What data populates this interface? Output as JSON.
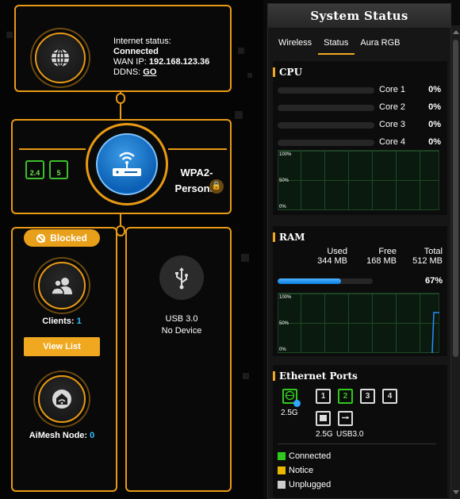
{
  "internet": {
    "status_label": "Internet status:",
    "status_value": "Connected",
    "wan_label": "WAN IP:",
    "wan_ip": "192.168.123.36",
    "ddns_label": "DDNS:",
    "ddns_link": "GO"
  },
  "router": {
    "band_24": "2.4",
    "band_5": "5",
    "security_line1": "WPA2-",
    "security_line2": "Personal"
  },
  "clients": {
    "blocked_label": "Blocked",
    "label": "Clients:",
    "count": "1",
    "view_list": "View List"
  },
  "aimesh": {
    "label": "AiMesh Node:",
    "count": "0"
  },
  "usb": {
    "type": "USB 3.0",
    "status": "No Device"
  },
  "system_status": {
    "title": "System Status",
    "tabs": [
      {
        "label": "Wireless",
        "active": false
      },
      {
        "label": "Status",
        "active": true
      },
      {
        "label": "Aura RGB",
        "active": false
      }
    ],
    "cpu": {
      "title": "CPU",
      "cores": [
        {
          "name": "Core 1",
          "usage": "0%"
        },
        {
          "name": "Core 2",
          "usage": "0%"
        },
        {
          "name": "Core 3",
          "usage": "0%"
        },
        {
          "name": "Core 4",
          "usage": "0%"
        }
      ],
      "graph_labels": [
        "100%",
        "50%",
        "0%"
      ]
    },
    "ram": {
      "title": "RAM",
      "used_label": "Used",
      "used_value": "344 MB",
      "free_label": "Free",
      "free_value": "168 MB",
      "total_label": "Total",
      "total_value": "512 MB",
      "usage_pct": "67%",
      "usage_fraction": 0.67,
      "graph_labels": [
        "100%",
        "50%",
        "0%"
      ]
    },
    "ethernet": {
      "title": "Ethernet Ports",
      "wan_port_label": "2.5G",
      "lan_ports": [
        "1",
        "2",
        "3",
        "4"
      ],
      "lan_25g_label": "2.5G",
      "usb3_label": "USB3.0",
      "legend": [
        {
          "label": "Connected",
          "color": "#30c81c"
        },
        {
          "label": "Notice",
          "color": "#e8b800"
        },
        {
          "label": "Unplugged",
          "color": "#cccccc"
        }
      ]
    }
  },
  "colors": {
    "accent": "#f0a820",
    "link": "#2fc0ff",
    "graph_line": "#2b8cff"
  }
}
